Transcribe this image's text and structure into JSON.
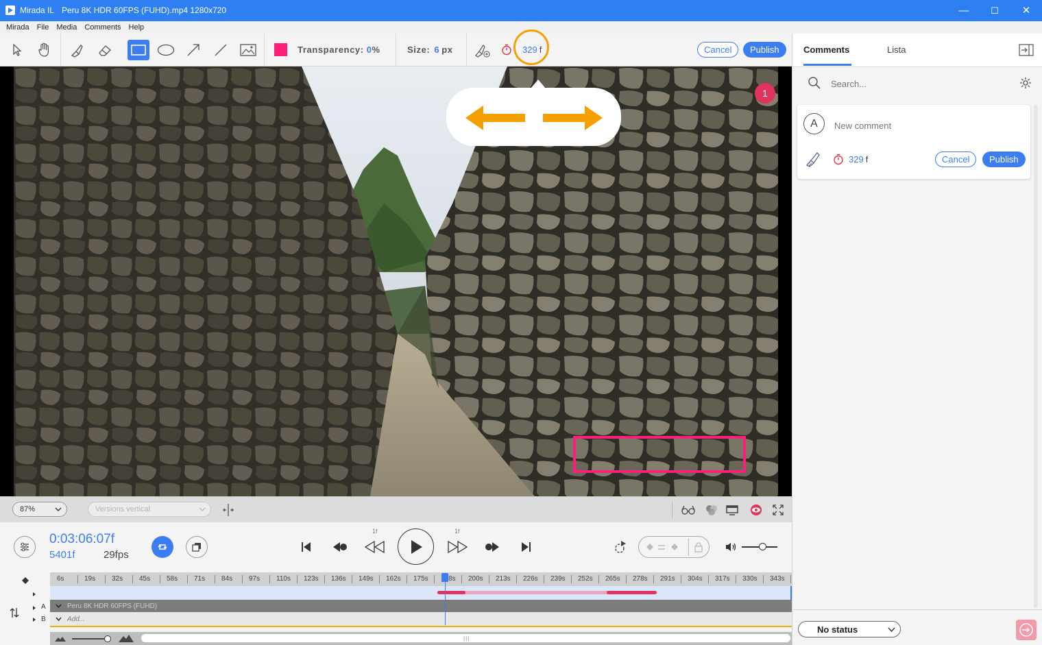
{
  "window": {
    "app_name": "Mirada IL",
    "file_title": "Peru 8K HDR 60FPS (FUHD).mp4 1280x720",
    "minimize": "—",
    "maximize": "☐",
    "close": "✕"
  },
  "menu": [
    "Mirada",
    "File",
    "Media",
    "Comments",
    "Help"
  ],
  "toolbar": {
    "tools": [
      "select-icon",
      "hand-icon",
      "brush-icon",
      "eraser-icon",
      "rectangle-icon",
      "ellipse-icon",
      "arrow-icon",
      "line-icon",
      "image-icon"
    ],
    "active_tool": "rectangle-icon",
    "color": "#ff1f7a",
    "transparency_label": "Transparency:",
    "transparency_value": "0",
    "transparency_unit": "%",
    "size_label": "Size:",
    "size_value": "6",
    "size_unit": "px",
    "frame_value": "329",
    "frame_unit": "f",
    "cancel": "Cancel",
    "publish": "Publish"
  },
  "video": {
    "marker_number": "1",
    "annotation_color": "#ff1f7a",
    "highlight_color": "#f5a000"
  },
  "controls": {
    "zoom": "87%",
    "versions": "Versions vertical"
  },
  "transport": {
    "timecode": "0:03:06:07f",
    "frames": "5401f",
    "fps": "29fps",
    "step_back_label": "1f",
    "step_fwd_label": "1f"
  },
  "timeline": {
    "ticks": [
      "6s",
      "19s",
      "32s",
      "45s",
      "58s",
      "71s",
      "84s",
      "97s",
      "110s",
      "123s",
      "136s",
      "149s",
      "162s",
      "175s",
      "188s",
      "200s",
      "213s",
      "226s",
      "239s",
      "252s",
      "265s",
      "278s",
      "291s",
      "304s",
      "317s",
      "330s",
      "343s"
    ],
    "track_a_label": "A",
    "track_b_label": "B",
    "track_a_name": "Peru 8K HDR 60FPS (FUHD)",
    "track_b_name": "Add..."
  },
  "panel": {
    "tab_comments": "Comments",
    "tab_lista": "Lista",
    "search_placeholder": "Search...",
    "avatar_letter": "A",
    "new_comment_placeholder": "New comment",
    "frame_value": "329",
    "frame_unit": "f",
    "cancel": "Cancel",
    "publish": "Publish",
    "status": "No status"
  }
}
